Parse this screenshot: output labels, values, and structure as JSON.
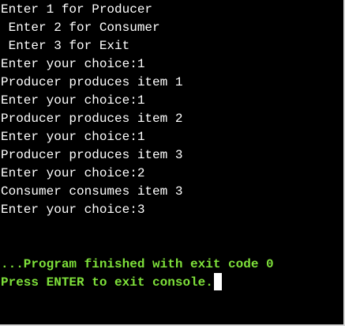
{
  "console": {
    "lines": [
      "Enter 1 for Producer",
      " Enter 2 for Consumer",
      " Enter 3 for Exit",
      "Enter your choice:1",
      "Producer produces item 1",
      "Enter your choice:1",
      "Producer produces item 2",
      "Enter your choice:1",
      "Producer produces item 3",
      "Enter your choice:2",
      "Consumer consumes item 3",
      "Enter your choice:3"
    ],
    "finished_message": "...Program finished with exit code 0",
    "exit_prompt": "Press ENTER to exit console."
  },
  "colors": {
    "background": "#000000",
    "text": "#ffffff",
    "status": "#7ee03a"
  }
}
